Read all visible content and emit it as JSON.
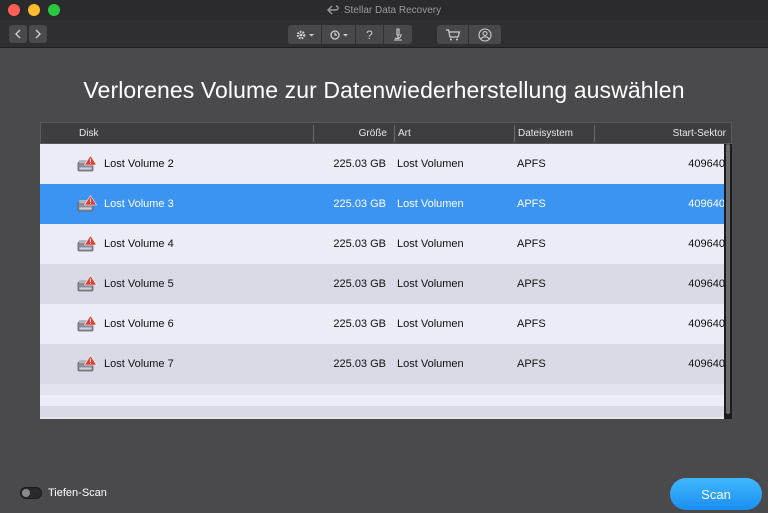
{
  "window": {
    "title": "Stellar Data Recovery",
    "traffic_colors": {
      "close": "#ff5f57",
      "minimize": "#febc2e",
      "maximize": "#28c840"
    }
  },
  "toolbar": {
    "back_icon": "chevron-left-icon",
    "forward_icon": "chevron-right-icon",
    "settings_icon": "gear-icon",
    "history_icon": "history-icon",
    "help_label": "?",
    "help_icon": "help-icon",
    "scan_icon": "microscope-icon",
    "cart_icon": "cart-icon",
    "account_icon": "user-icon"
  },
  "heading": "Verlorenes Volume zur Datenwiederherstellung auswählen",
  "table": {
    "columns": {
      "disk": "Disk",
      "size": "Größe",
      "type": "Art",
      "filesystem": "Dateisystem",
      "start": "Start-Sektor"
    },
    "rows": [
      {
        "name": "Lost Volume 2",
        "size": "225.03 GB",
        "type": "Lost Volumen",
        "filesystem": "APFS",
        "start": "409640"
      },
      {
        "name": "Lost Volume 3",
        "size": "225.03 GB",
        "type": "Lost Volumen",
        "filesystem": "APFS",
        "start": "409640"
      },
      {
        "name": "Lost Volume 4",
        "size": "225.03 GB",
        "type": "Lost Volumen",
        "filesystem": "APFS",
        "start": "409640"
      },
      {
        "name": "Lost Volume 5",
        "size": "225.03 GB",
        "type": "Lost Volumen",
        "filesystem": "APFS",
        "start": "409640"
      },
      {
        "name": "Lost Volume 6",
        "size": "225.03 GB",
        "type": "Lost Volumen",
        "filesystem": "APFS",
        "start": "409640"
      },
      {
        "name": "Lost Volume 7",
        "size": "225.03 GB",
        "type": "Lost Volumen",
        "filesystem": "APFS",
        "start": "409640"
      }
    ],
    "selected_index": 1,
    "row_icon": "hard-drive-warning-icon",
    "selection_color": "#3b93f2"
  },
  "footer": {
    "deep_scan_label": "Tiefen-Scan",
    "deep_scan_enabled": false,
    "scan_button": "Scan",
    "scan_color": "#2ba3f8"
  }
}
